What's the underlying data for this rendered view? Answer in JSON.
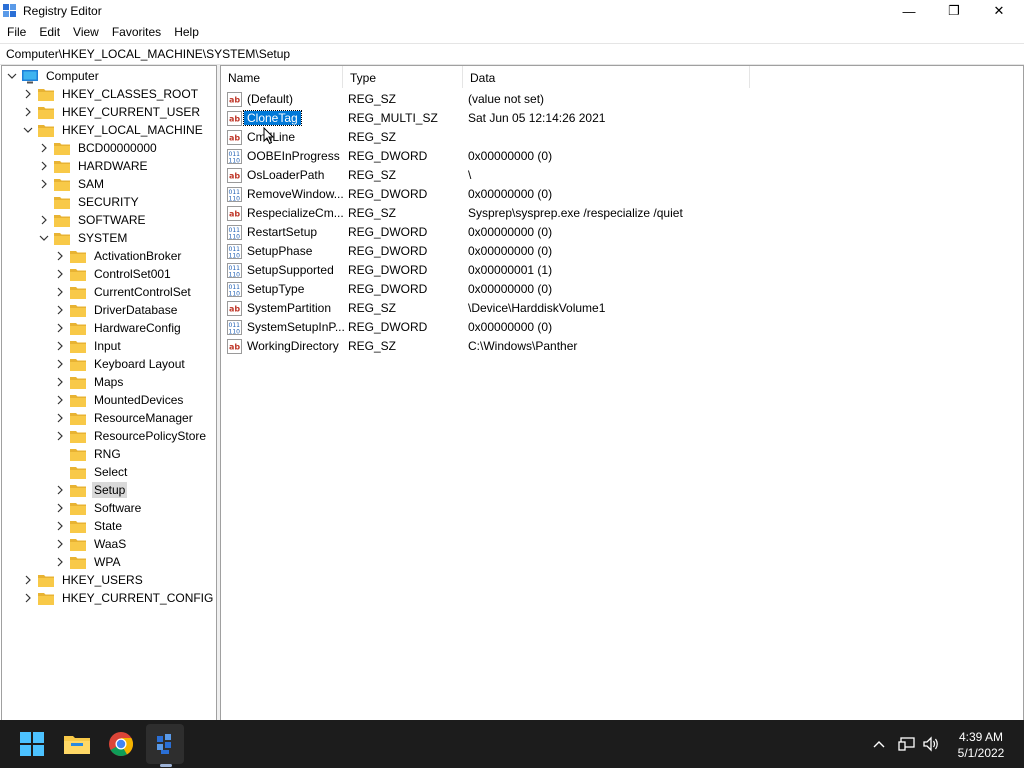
{
  "window": {
    "title": "Registry Editor",
    "controls": {
      "minimize": "—",
      "maximize": "❐",
      "close": "✕"
    }
  },
  "menu": [
    "File",
    "Edit",
    "View",
    "Favorites",
    "Help"
  ],
  "address": "Computer\\HKEY_LOCAL_MACHINE\\SYSTEM\\Setup",
  "tree": {
    "root": "Computer",
    "hives": [
      "HKEY_CLASSES_ROOT",
      "HKEY_CURRENT_USER",
      "HKEY_LOCAL_MACHINE"
    ],
    "hklm_children": [
      "BCD00000000",
      "HARDWARE",
      "SAM",
      "SECURITY",
      "SOFTWARE",
      "SYSTEM"
    ],
    "system_children": [
      "ActivationBroker",
      "ControlSet001",
      "CurrentControlSet",
      "DriverDatabase",
      "HardwareConfig",
      "Input",
      "Keyboard Layout",
      "Maps",
      "MountedDevices",
      "ResourceManager",
      "ResourcePolicyStore",
      "RNG",
      "Select",
      "Setup",
      "Software",
      "State",
      "WaaS",
      "WPA"
    ],
    "hives_after": [
      "HKEY_USERS",
      "HKEY_CURRENT_CONFIG"
    ]
  },
  "columns": {
    "name": "Name",
    "type": "Type",
    "data": "Data"
  },
  "values": [
    {
      "name": "(Default)",
      "type": "REG_SZ",
      "data": "(value not set)",
      "icon": "string-value-icon"
    },
    {
      "name": "CloneTag",
      "type": "REG_MULTI_SZ",
      "data": "Sat Jun 05 12:14:26 2021",
      "icon": "string-value-icon"
    },
    {
      "name": "CmdLine",
      "type": "REG_SZ",
      "data": "",
      "icon": "string-value-icon"
    },
    {
      "name": "OOBEInProgress",
      "type": "REG_DWORD",
      "data": "0x00000000 (0)",
      "icon": "binary-value-icon"
    },
    {
      "name": "OsLoaderPath",
      "type": "REG_SZ",
      "data": "\\",
      "icon": "string-value-icon"
    },
    {
      "name": "RemoveWindow...",
      "type": "REG_DWORD",
      "data": "0x00000000 (0)",
      "icon": "binary-value-icon"
    },
    {
      "name": "RespecializeCm...",
      "type": "REG_SZ",
      "data": "Sysprep\\sysprep.exe /respecialize /quiet",
      "icon": "string-value-icon"
    },
    {
      "name": "RestartSetup",
      "type": "REG_DWORD",
      "data": "0x00000000 (0)",
      "icon": "binary-value-icon"
    },
    {
      "name": "SetupPhase",
      "type": "REG_DWORD",
      "data": "0x00000000 (0)",
      "icon": "binary-value-icon"
    },
    {
      "name": "SetupSupported",
      "type": "REG_DWORD",
      "data": "0x00000001 (1)",
      "icon": "binary-value-icon"
    },
    {
      "name": "SetupType",
      "type": "REG_DWORD",
      "data": "0x00000000 (0)",
      "icon": "binary-value-icon"
    },
    {
      "name": "SystemPartition",
      "type": "REG_SZ",
      "data": "\\Device\\HarddiskVolume1",
      "icon": "string-value-icon"
    },
    {
      "name": "SystemSetupInP...",
      "type": "REG_DWORD",
      "data": "0x00000000 (0)",
      "icon": "binary-value-icon"
    },
    {
      "name": "WorkingDirectory",
      "type": "REG_SZ",
      "data": "C:\\Windows\\Panther",
      "icon": "string-value-icon"
    }
  ],
  "taskbar": {
    "time": "4:39 AM",
    "date": "5/1/2022"
  },
  "colors": {
    "selection": "#0078d7",
    "folder": "#f8c948",
    "taskbar": "#1c1c1c"
  }
}
